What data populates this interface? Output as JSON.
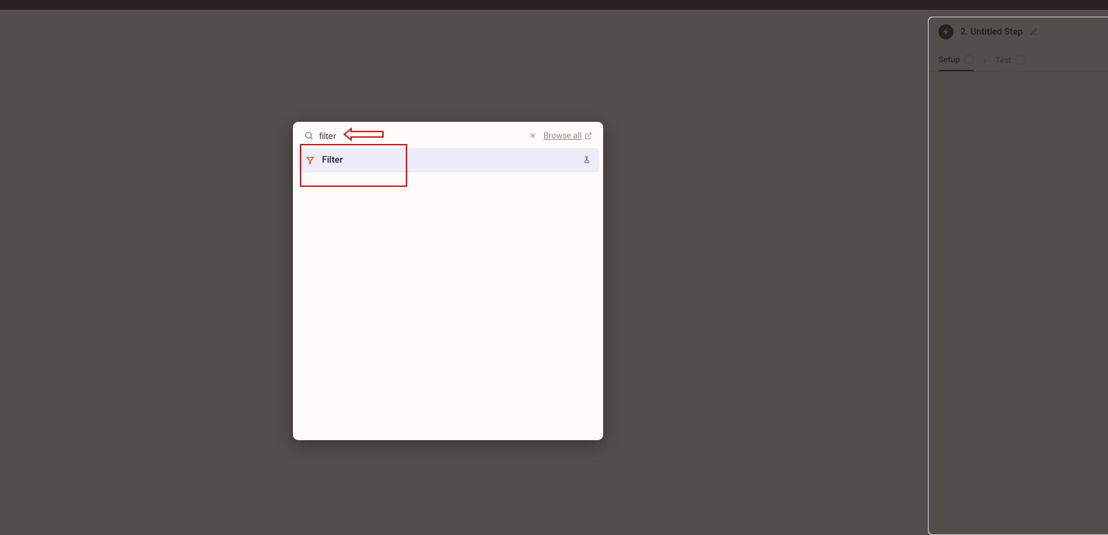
{
  "sidePanel": {
    "stepTitle": "2. Untitled Step",
    "tabs": {
      "setup": "Setup",
      "test": "Test"
    }
  },
  "search": {
    "value": "filter",
    "browseAll": "Browse all",
    "results": [
      {
        "label": "Filter",
        "icon": "filter-icon",
        "highlighted": true
      }
    ]
  }
}
